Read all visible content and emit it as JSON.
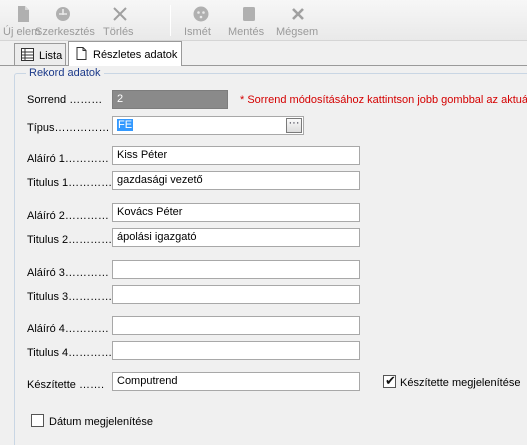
{
  "toolbar": {
    "buttons": [
      {
        "label": "Új elem",
        "icon": "new-item-icon"
      },
      {
        "label": "Szerkesztés",
        "icon": "edit-icon"
      },
      {
        "label": "Törlés",
        "icon": "delete-icon"
      },
      {
        "label": "Ismét",
        "icon": "repeat-icon"
      },
      {
        "label": "Mentés",
        "icon": "save-icon"
      },
      {
        "label": "Mégsem",
        "icon": "cancel-icon"
      }
    ]
  },
  "tabs": [
    {
      "label": "Lista",
      "icon": "list-icon"
    },
    {
      "label": "Részletes adatok",
      "icon": "document-icon"
    }
  ],
  "group": {
    "title": "Rekord adatok"
  },
  "form": {
    "sorrend_label": "Sorrend ………",
    "sorrend_value": "2",
    "sorrend_note": "* Sorrend módosításához kattintson jobb gombbal az aktuáli",
    "tipus_label": "Típus……………",
    "tipus_value": "FE",
    "tipus_button": "···",
    "signers": [
      {
        "alairo_label": "Aláíró 1…………",
        "alairo_value": "Kiss Péter",
        "titulus_label": "Titulus 1…………",
        "titulus_value": "gazdasági vezető"
      },
      {
        "alairo_label": "Aláíró 2…………",
        "alairo_value": "Kovács Péter",
        "titulus_label": "Titulus 2…………",
        "titulus_value": "ápolási igazgató"
      },
      {
        "alairo_label": "Aláíró 3…………",
        "alairo_value": "",
        "titulus_label": "Titulus 3…………",
        "titulus_value": ""
      },
      {
        "alairo_label": "Aláíró 4…………",
        "alairo_value": "",
        "titulus_label": "Titulus 4…………",
        "titulus_value": ""
      }
    ],
    "keszitette_label": "Készítette …….",
    "keszitette_value": "Computrend",
    "keszitette_show_label": "Készítette megjelenítése",
    "keszitette_show_checked": true,
    "datum_show_label": "Dátum megjelenítése",
    "datum_show_checked": false
  },
  "colors": {
    "accent": "#1c3a8a",
    "note": "#d40000",
    "readonly": "#8a8a8a"
  }
}
